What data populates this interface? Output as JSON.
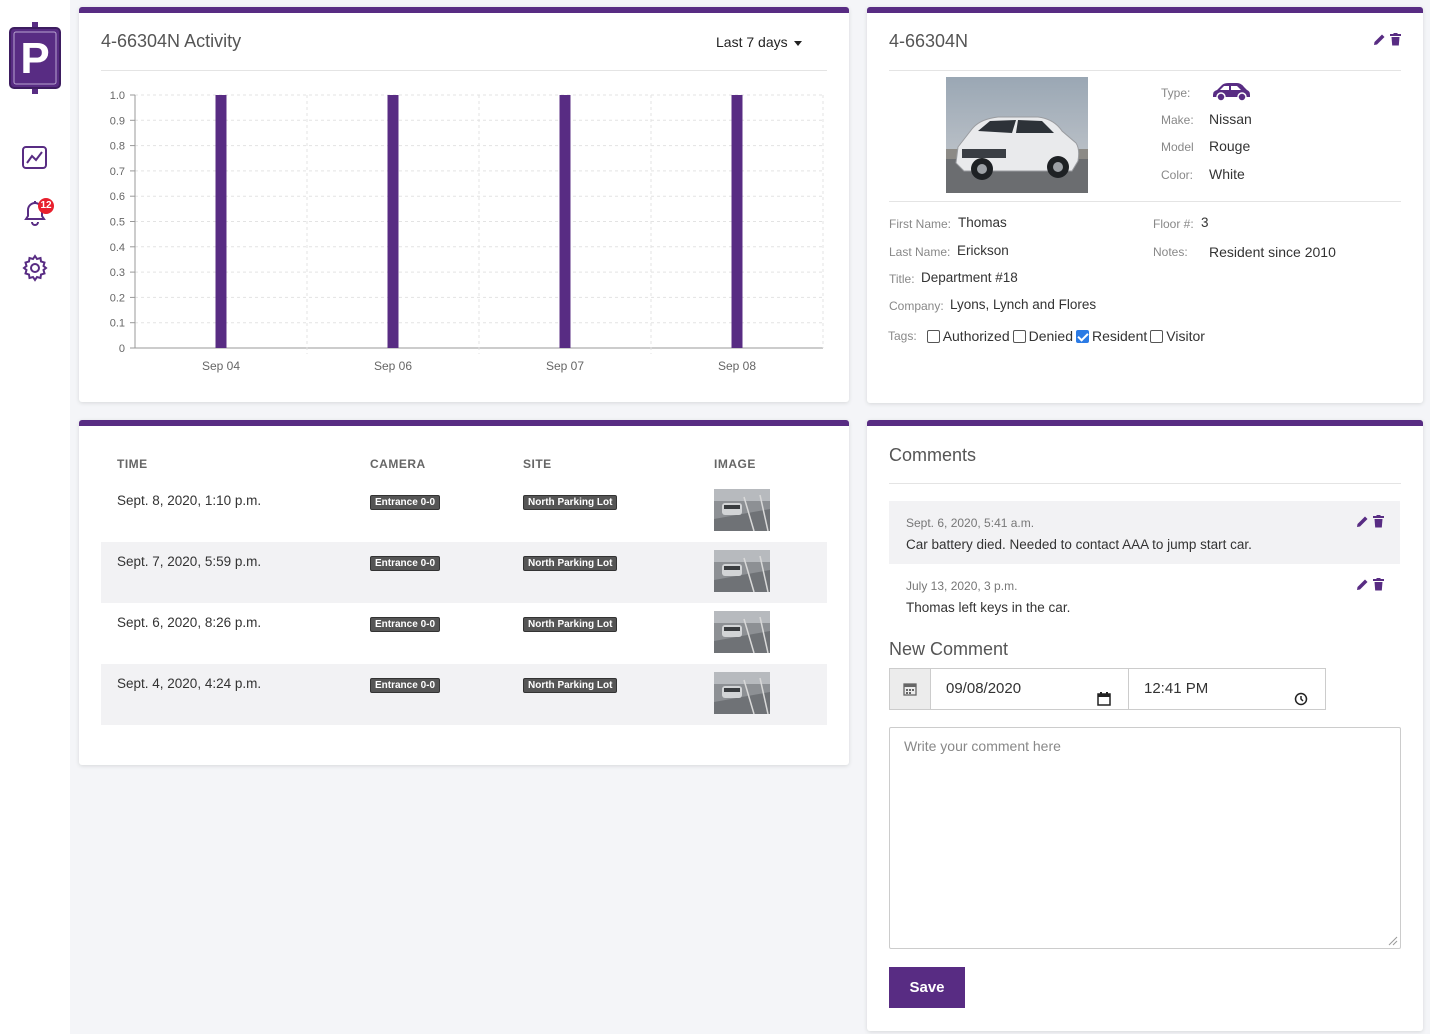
{
  "sidebar": {
    "logo_letter": "P",
    "notification_count": "12"
  },
  "activity": {
    "title": "4-66304N Activity",
    "range_label": "Last 7 days"
  },
  "chart_data": {
    "type": "bar",
    "categories": [
      "Sep 04",
      "Sep 06",
      "Sep 07",
      "Sep 08"
    ],
    "values": [
      1,
      1,
      1,
      1
    ],
    "yticks": [
      "0",
      "0.1",
      "0.2",
      "0.3",
      "0.4",
      "0.5",
      "0.6",
      "0.7",
      "0.8",
      "0.9",
      "1.0"
    ],
    "ylim": [
      0,
      1
    ],
    "grid": true,
    "color": "#582c83"
  },
  "vehicle": {
    "plate": "4-66304N",
    "type_label": "Type:",
    "make_label": "Make:",
    "make": "Nissan",
    "model_label": "Model",
    "model": "Rouge",
    "color_label": "Color:",
    "color": "White"
  },
  "owner": {
    "first_name_label": "First Name:",
    "first_name": "Thomas",
    "last_name_label": "Last Name:",
    "last_name": "Erickson",
    "title_label": "Title:",
    "title": "Department #18",
    "company_label": "Company:",
    "company": "Lyons, Lynch and Flores",
    "floor_label": "Floor #:",
    "floor": "3",
    "notes_label": "Notes:",
    "notes": "Resident since 2010"
  },
  "tags": {
    "label": "Tags:",
    "items": [
      {
        "name": "Authorized",
        "checked": false
      },
      {
        "name": "Denied",
        "checked": false
      },
      {
        "name": "Resident",
        "checked": true
      },
      {
        "name": "Visitor",
        "checked": false
      }
    ]
  },
  "table": {
    "headers": [
      "TIME",
      "CAMERA",
      "SITE",
      "IMAGE"
    ],
    "rows": [
      {
        "time": "Sept. 8, 2020, 1:10 p.m.",
        "camera": "Entrance 0-0",
        "site": "North Parking Lot"
      },
      {
        "time": "Sept. 7, 2020, 5:59 p.m.",
        "camera": "Entrance 0-0",
        "site": "North Parking Lot"
      },
      {
        "time": "Sept. 6, 2020, 8:26 p.m.",
        "camera": "Entrance 0-0",
        "site": "North Parking Lot"
      },
      {
        "time": "Sept. 4, 2020, 4:24 p.m.",
        "camera": "Entrance 0-0",
        "site": "North Parking Lot"
      }
    ]
  },
  "comments": {
    "title": "Comments",
    "items": [
      {
        "date": "Sept. 6, 2020, 5:41 a.m.",
        "text": "Car battery died. Needed to contact AAA to jump start car."
      },
      {
        "date": "July 13, 2020, 3 p.m.",
        "text": "Thomas left keys in the car."
      }
    ],
    "new_title": "New Comment",
    "date_value": "09/08/2020",
    "time_value": "12:41 PM",
    "placeholder": "Write your comment here",
    "save_label": "Save"
  },
  "colors": {
    "brand": "#582c83",
    "badge": "#e8202e",
    "checkbox": "#2c7be5"
  }
}
